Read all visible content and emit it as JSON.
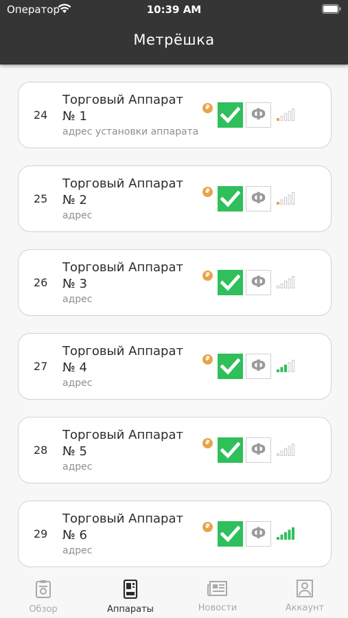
{
  "status_bar": {
    "carrier": "Оператор",
    "time": "10:39 AM"
  },
  "header": {
    "title": "Метрёшка"
  },
  "colors": {
    "accent_green": "#2fbf5b",
    "coin_orange": "#e8a44a",
    "signal_green": "#2fbf5b",
    "signal_orange": "#e8a44a"
  },
  "machines": [
    {
      "number": "24",
      "name": "Торговый Аппарат № 1",
      "address": "адрес установки аппарата",
      "signal_level": 1,
      "signal_color": "orange"
    },
    {
      "number": "25",
      "name": "Торговый Аппарат № 2",
      "address": "адрес",
      "signal_level": 1,
      "signal_color": "orange"
    },
    {
      "number": "26",
      "name": "Торговый Аппарат № 3",
      "address": "адрес",
      "signal_level": 0,
      "signal_color": "gray"
    },
    {
      "number": "27",
      "name": "Торговый Аппарат № 4",
      "address": "адрес",
      "signal_level": 3,
      "signal_color": "green"
    },
    {
      "number": "28",
      "name": "Торговый Аппарат № 5",
      "address": "адрес",
      "signal_level": 0,
      "signal_color": "gray"
    },
    {
      "number": "29",
      "name": "Торговый Аппарат № 6",
      "address": "адрес",
      "signal_level": 5,
      "signal_color": "green"
    }
  ],
  "card_badges": {
    "coin_icon": "ruble-coin-icon",
    "coin_symbol": "₽",
    "check_icon": "check-icon",
    "fiscal_label": "Ф"
  },
  "tabs": [
    {
      "label": "Обзор",
      "icon": "overview-icon",
      "active": false
    },
    {
      "label": "Аппараты",
      "icon": "machines-icon",
      "active": true
    },
    {
      "label": "Новости",
      "icon": "news-icon",
      "active": false
    },
    {
      "label": "Аккаунт",
      "icon": "account-icon",
      "active": false
    }
  ]
}
